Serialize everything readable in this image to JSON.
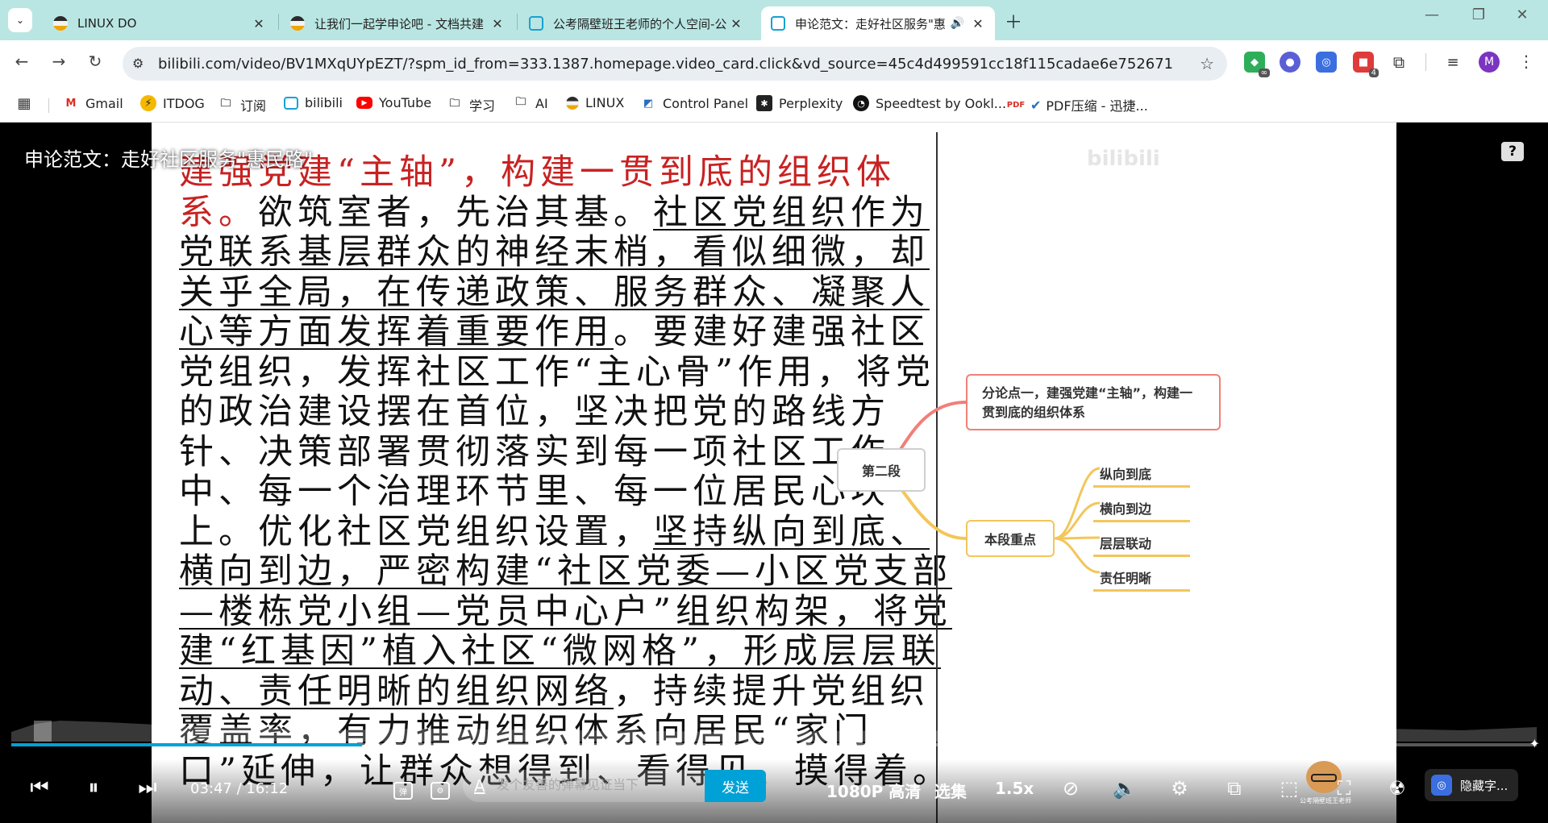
{
  "browser": {
    "tabs": [
      {
        "title": "LINUX DO",
        "favicon": "linuxdo-icon",
        "active": false
      },
      {
        "title": "让我们一起学申论吧 - 文档共建",
        "favicon": "linuxdo-icon",
        "active": false
      },
      {
        "title": "公考隔壁班王老师的个人空间-公",
        "favicon": "bilibili-icon",
        "active": false
      },
      {
        "title": "申论范文：走好社区服务\"惠",
        "favicon": "bilibili-icon",
        "active": true
      }
    ],
    "url": "bilibili.com/video/BV1MXqUYpEZT/?spm_id_from=333.1387.homepage.video_card.click&vd_source=45c4d499591cc18f115cadae6e752671",
    "extension_badges": {
      "ext1": "∞",
      "ext4": "4"
    },
    "profile_initial": "M",
    "accent": "#b9e6e3"
  },
  "bookmarks": [
    {
      "label": "Gmail",
      "icon": "gmail-icon"
    },
    {
      "label": "ITDOG",
      "icon": "itdog-icon"
    },
    {
      "label": "订阅",
      "icon": "folder-icon"
    },
    {
      "label": "bilibili",
      "icon": "bilibili-icon"
    },
    {
      "label": "YouTube",
      "icon": "youtube-icon"
    },
    {
      "label": "学习",
      "icon": "folder-icon"
    },
    {
      "label": "AI",
      "icon": "folder-icon"
    },
    {
      "label": "LINUX",
      "icon": "linuxdo-icon"
    },
    {
      "label": "Control Panel",
      "icon": "control-panel-icon"
    },
    {
      "label": "Perplexity",
      "icon": "perplexity-icon"
    },
    {
      "label": "Speedtest by Ookl...",
      "icon": "speedtest-icon"
    },
    {
      "label": "PDF压缩 - 迅捷...",
      "icon": "pdf-icon"
    }
  ],
  "video": {
    "title": "申论范文：走好社区服务\"惠民路\"",
    "essay_parts": [
      {
        "text": "建强党建“主轴”，构建一贯到底的组织体系。",
        "style": "red"
      },
      {
        "text": "欲筑室者，先治其基。",
        "style": "plain"
      },
      {
        "text": "社区党组织作为党联系基层群众的神经末梢，看似细微，却关乎全局，在传递政策、服务群众、凝聚人心等方面发挥着重要作用",
        "style": "ul"
      },
      {
        "text": "。要建好建强社区党组织，发挥社区工作“主心骨”作用，将党的政治建设摆在首位，坚决把党的路线方针、决策部署贯彻落实到每一项社区工作中、每一个治理环节里、每一位居民心坎上。优化社区党组织设置，",
        "style": "plain"
      },
      {
        "text": "坚持纵向到底、横向到边，严密构建“社区党委—小区党支部—楼栋党小组—党员中心户”组织构架，将党建“红基因”植入社区“微网格”，形成层层联动、责任明晰的组织网络",
        "style": "ul"
      },
      {
        "text": "，持续提升党组织覆盖率，有力推动组织体系向居民“家门口”延伸，让群众想得到、看得见、摸得着。",
        "style": "plain"
      }
    ],
    "mindmap": {
      "root": "第二段",
      "point": "分论点一，建强党建“主轴”，构建一贯到底的组织体系",
      "key": "本段重点",
      "leaves": [
        "纵向到底",
        "横向到边",
        "层层联动",
        "责任明晰"
      ]
    },
    "progress": 0.23,
    "time_current": "03:47",
    "time_total": "16:12",
    "danmaku_placeholder": "发个友善的弹幕见证当下",
    "send_label": "发送",
    "quality_label": "1080P 高清",
    "episodes_label": "选集",
    "speed_label": "1.5x",
    "mascot_label": "公考隔壁班王老师",
    "subtitle_label": "隐藏字..."
  }
}
